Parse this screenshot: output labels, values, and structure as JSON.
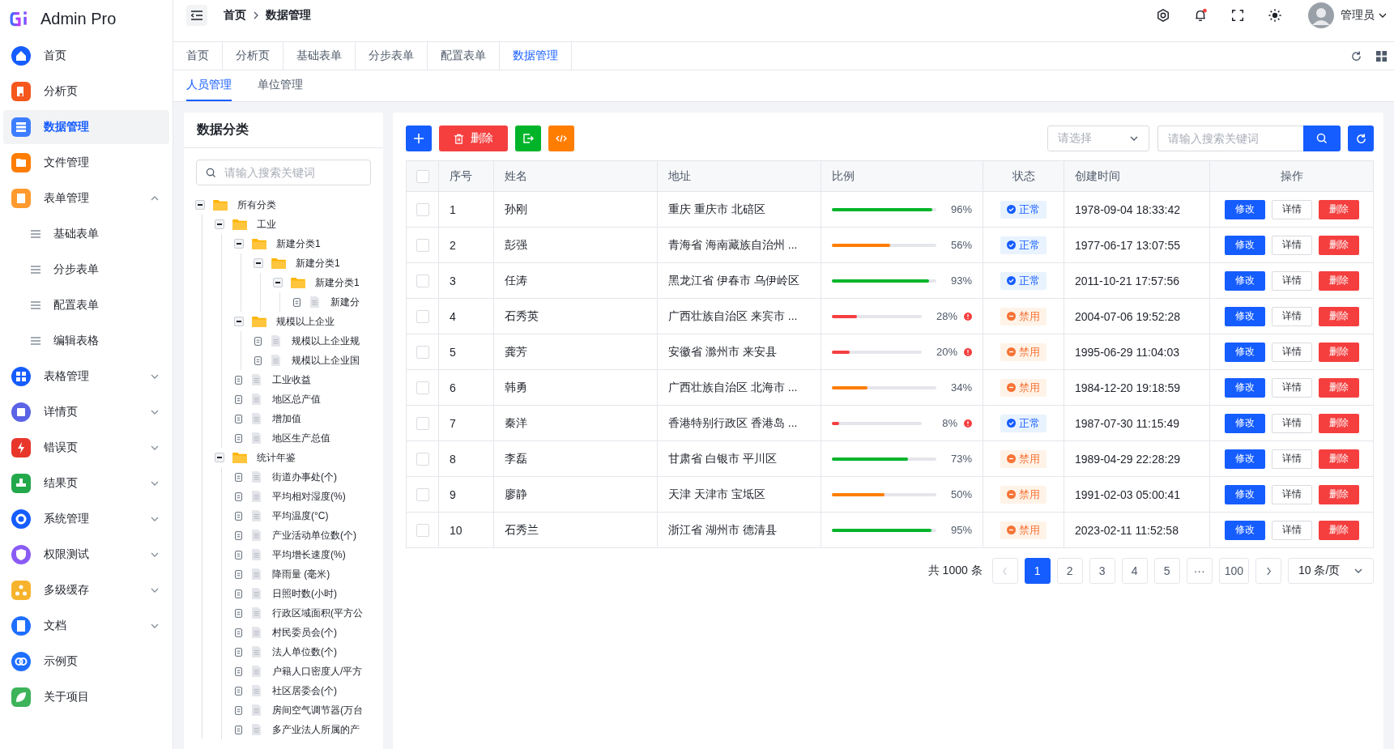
{
  "app": {
    "name": "Admin Pro"
  },
  "sidebar": {
    "items": [
      {
        "label": "首页",
        "color": "#165dff",
        "selected": false
      },
      {
        "label": "分析页",
        "color": "#f5571d",
        "selected": false
      },
      {
        "label": "数据管理",
        "color": "#3c7eff",
        "selected": true
      },
      {
        "label": "文件管理",
        "color": "#ff7d00",
        "selected": false
      },
      {
        "label": "表单管理",
        "color": "#ff9a2e",
        "selected": false,
        "expanded": true,
        "children": [
          {
            "label": "基础表单",
            "selected": false
          },
          {
            "label": "分步表单",
            "selected": false
          },
          {
            "label": "配置表单",
            "selected": false
          },
          {
            "label": "编辑表格",
            "selected": false
          }
        ]
      },
      {
        "label": "表格管理",
        "color": "#165dff",
        "selected": false,
        "expanded": false
      },
      {
        "label": "详情页",
        "color": "#5b63e6",
        "selected": false,
        "expanded": false
      },
      {
        "label": "错误页",
        "color": "#e8362b",
        "selected": false,
        "expanded": false
      },
      {
        "label": "结果页",
        "color": "#23a84b",
        "selected": false,
        "expanded": false
      },
      {
        "label": "系统管理",
        "color": "#165dff",
        "selected": false,
        "expanded": false
      },
      {
        "label": "权限测试",
        "color": "#8a5cf5",
        "selected": false,
        "expanded": false
      },
      {
        "label": "多级缓存",
        "color": "#f7b32b",
        "selected": false,
        "expanded": false
      },
      {
        "label": "文档",
        "color": "#1f6fff",
        "selected": false,
        "expanded": false
      },
      {
        "label": "示例页",
        "color": "#1f6fff",
        "selected": false
      },
      {
        "label": "关于项目",
        "color": "#3db35a",
        "selected": false
      }
    ]
  },
  "header": {
    "breadcrumb": [
      "首页",
      "数据管理"
    ],
    "notification": {
      "unread": true
    },
    "user": "管理员"
  },
  "tabs": [
    {
      "label": "首页",
      "selected": false
    },
    {
      "label": "分析页",
      "selected": false
    },
    {
      "label": "基础表单",
      "selected": false
    },
    {
      "label": "分步表单",
      "selected": false
    },
    {
      "label": "配置表单",
      "selected": false
    },
    {
      "label": "数据管理",
      "selected": true
    }
  ],
  "subtabs": [
    {
      "label": "人员管理",
      "selected": true
    },
    {
      "label": "单位管理",
      "selected": false
    }
  ],
  "category_panel": {
    "title": "数据分类",
    "search": {
      "placeholder": "请输入搜索关键词"
    },
    "tree": [
      {
        "label": "所有分类",
        "expanded": true,
        "children": [
          {
            "label": "工业",
            "expanded": true,
            "children": [
              {
                "label": "新建分类1",
                "expanded": true,
                "children": [
                  {
                    "label": "新建分类1",
                    "expanded": true,
                    "children": [
                      {
                        "label": "新建分类1",
                        "expanded": true,
                        "children": [
                          {
                            "label": "新建分"
                          }
                        ]
                      }
                    ]
                  }
                ]
              },
              {
                "label": "规模以上企业",
                "expanded": true,
                "children": [
                  {
                    "label": "规模以上企业规"
                  },
                  {
                    "label": "规模以上企业国"
                  }
                ]
              },
              {
                "label": "工业收益"
              },
              {
                "label": "地区总产值"
              },
              {
                "label": "增加值"
              },
              {
                "label": "地区生产总值"
              }
            ]
          },
          {
            "label": "统计年鉴",
            "expanded": true,
            "children": [
              {
                "label": "街道办事处(个)"
              },
              {
                "label": "平均相对湿度(%)"
              },
              {
                "label": "平均温度(°C)"
              },
              {
                "label": "产业活动单位数(个)"
              },
              {
                "label": "平均增长速度(%)"
              },
              {
                "label": "降雨量 (毫米)"
              },
              {
                "label": "日照时数(小时)"
              },
              {
                "label": "行政区域面积(平方公"
              },
              {
                "label": "村民委员会(个)"
              },
              {
                "label": "法人单位数(个)"
              },
              {
                "label": "户籍人口密度人/平方"
              },
              {
                "label": "社区居委会(个)"
              },
              {
                "label": "房间空气调节器(万台"
              },
              {
                "label": "多产业法人所属的产"
              }
            ]
          }
        ]
      }
    ]
  },
  "toolbar": {
    "delete": "删除",
    "select": {
      "placeholder": "请选择"
    },
    "search": {
      "placeholder": "请输入搜索关键词"
    }
  },
  "table": {
    "all_checked": false,
    "columns": [
      "序号",
      "姓名",
      "地址",
      "比例",
      "状态",
      "创建时间",
      "操作"
    ],
    "rows": [
      {
        "checked": false,
        "index": "1",
        "name": "孙刚",
        "address": "重庆 重庆市 北碚区",
        "level": 0.96,
        "percent": "96%",
        "status": {
          "kind": "normal",
          "label": "正常"
        },
        "created": "1978-09-04 18:33:42",
        "actions": [
          "修改",
          "详情",
          "删除"
        ]
      },
      {
        "checked": false,
        "index": "2",
        "name": "彭强",
        "address": "青海省 海南藏族自治州 ...",
        "level": 0.56,
        "percent": "56%",
        "status": {
          "kind": "normal",
          "label": "正常"
        },
        "created": "1977-06-17 13:07:55",
        "actions": [
          "修改",
          "详情",
          "删除"
        ]
      },
      {
        "checked": false,
        "index": "3",
        "name": "任涛",
        "address": "黑龙江省 伊春市 乌伊岭区",
        "level": 0.93,
        "percent": "93%",
        "status": {
          "kind": "normal",
          "label": "正常"
        },
        "created": "2011-10-21 17:57:56",
        "actions": [
          "修改",
          "详情",
          "删除"
        ]
      },
      {
        "checked": false,
        "index": "4",
        "name": "石秀英",
        "address": "广西壮族自治区 来宾市 ...",
        "level": 0.28,
        "percent": "28%",
        "status": {
          "kind": "disabled",
          "label": "禁用"
        },
        "created": "2004-07-06 19:52:28",
        "actions": [
          "修改",
          "详情",
          "删除"
        ]
      },
      {
        "checked": false,
        "index": "5",
        "name": "龚芳",
        "address": "安徽省 滁州市 来安县",
        "level": 0.2,
        "percent": "20%",
        "status": {
          "kind": "disabled",
          "label": "禁用"
        },
        "created": "1995-06-29 11:04:03",
        "actions": [
          "修改",
          "详情",
          "删除"
        ]
      },
      {
        "checked": false,
        "index": "6",
        "name": "韩勇",
        "address": "广西壮族自治区 北海市 ...",
        "level": 0.34,
        "percent": "34%",
        "status": {
          "kind": "disabled",
          "label": "禁用"
        },
        "created": "1984-12-20 19:18:59",
        "actions": [
          "修改",
          "详情",
          "删除"
        ]
      },
      {
        "checked": false,
        "index": "7",
        "name": "秦洋",
        "address": "香港特别行政区 香港岛 ...",
        "level": 0.08,
        "percent": "8%",
        "status": {
          "kind": "normal",
          "label": "正常"
        },
        "created": "1987-07-30 11:15:49",
        "actions": [
          "修改",
          "详情",
          "删除"
        ]
      },
      {
        "checked": false,
        "index": "8",
        "name": "李磊",
        "address": "甘肃省 白银市 平川区",
        "level": 0.73,
        "percent": "73%",
        "status": {
          "kind": "disabled",
          "label": "禁用"
        },
        "created": "1989-04-29 22:28:29",
        "actions": [
          "修改",
          "详情",
          "删除"
        ]
      },
      {
        "checked": false,
        "index": "9",
        "name": "廖静",
        "address": "天津 天津市 宝坻区",
        "level": 0.5,
        "percent": "50%",
        "status": {
          "kind": "disabled",
          "label": "禁用"
        },
        "created": "1991-02-03 05:00:41",
        "actions": [
          "修改",
          "详情",
          "删除"
        ]
      },
      {
        "checked": false,
        "index": "10",
        "name": "石秀兰",
        "address": "浙江省 湖州市 德清县",
        "level": 0.95,
        "percent": "95%",
        "status": {
          "kind": "disabled",
          "label": "禁用"
        },
        "created": "2023-02-11 11:52:58",
        "actions": [
          "修改",
          "详情",
          "删除"
        ]
      }
    ]
  },
  "pagination": {
    "total": "共 1000 条",
    "prev_disabled": true,
    "pages": [
      {
        "label": "1",
        "selected": true
      },
      {
        "label": "2",
        "selected": false
      },
      {
        "label": "3",
        "selected": false
      },
      {
        "label": "4",
        "selected": false
      },
      {
        "label": "5",
        "selected": false
      },
      {
        "label": "···",
        "selected": false
      },
      {
        "label": "100",
        "selected": false
      }
    ],
    "page_size": "10 条/页"
  }
}
